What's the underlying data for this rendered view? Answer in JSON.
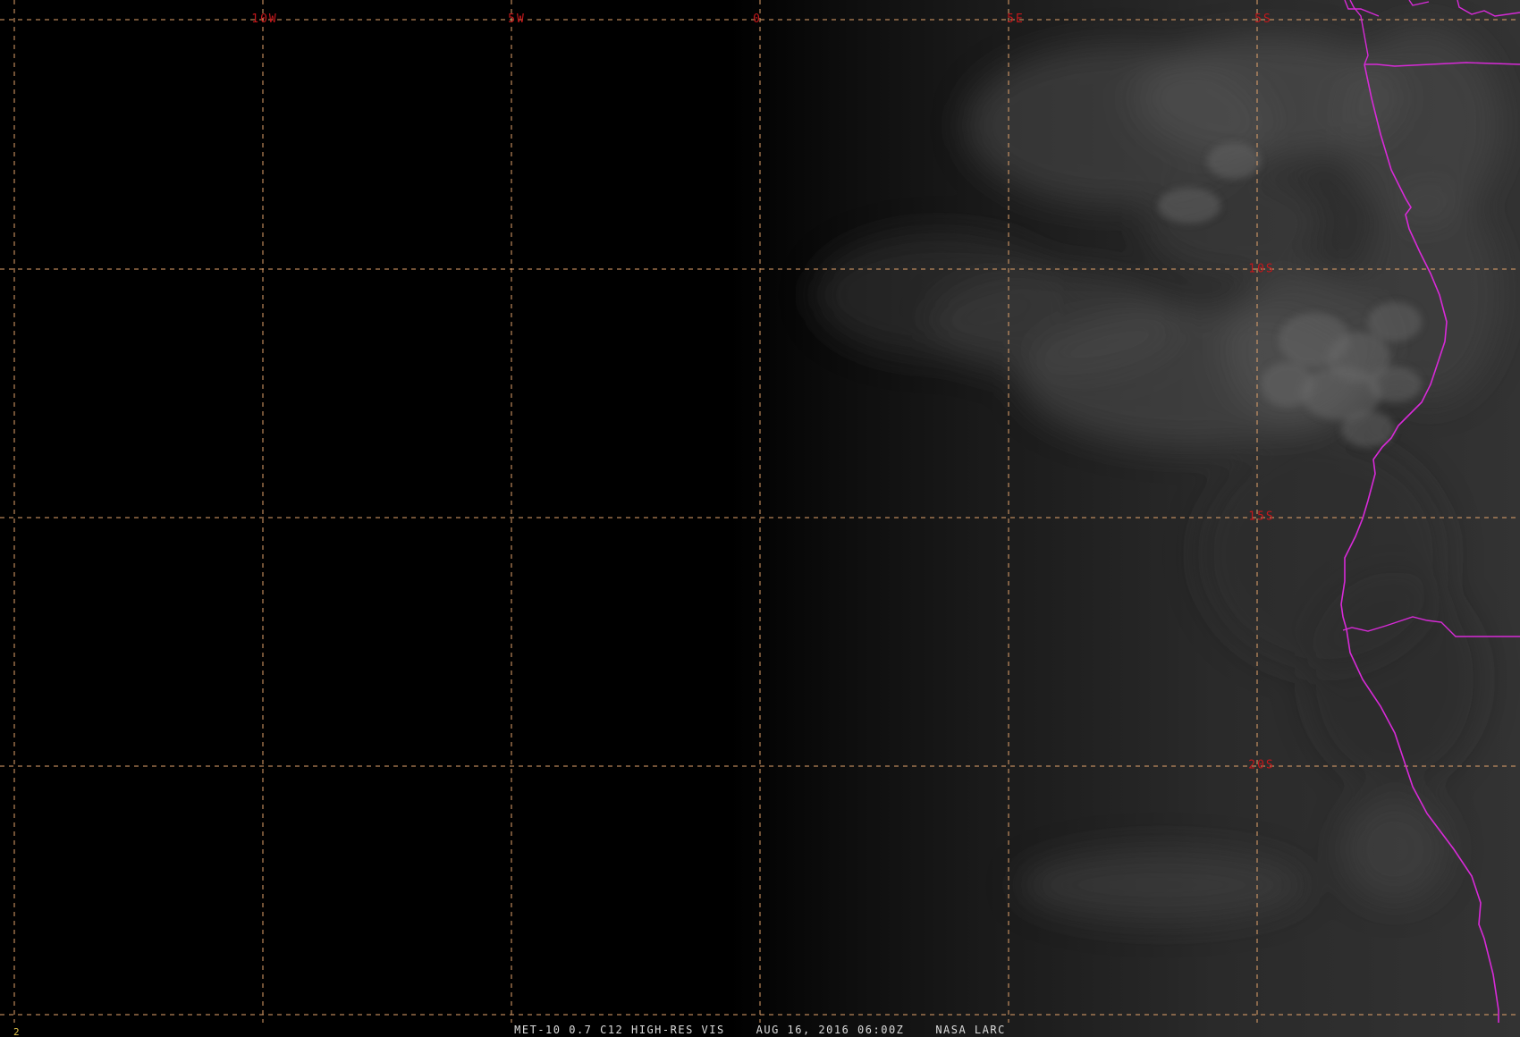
{
  "map": {
    "lon_labels": [
      "10W",
      "5W",
      "0",
      "5E",
      "5S"
    ],
    "lat_labels": [
      "10S",
      "15S",
      "20S"
    ],
    "colors": {
      "graticule": "#e3a36b",
      "grid_label": "#c4171b",
      "coastline": "#d82ad8",
      "footer_text": "#dcdcdc",
      "frame_number": "#e0c24a"
    }
  },
  "footer": {
    "frame_number": "2",
    "product": "MET-10 0.7 C12 HIGH-RES VIS",
    "timestamp": "AUG 16, 2016 06:00Z",
    "source": "NASA LARC"
  }
}
